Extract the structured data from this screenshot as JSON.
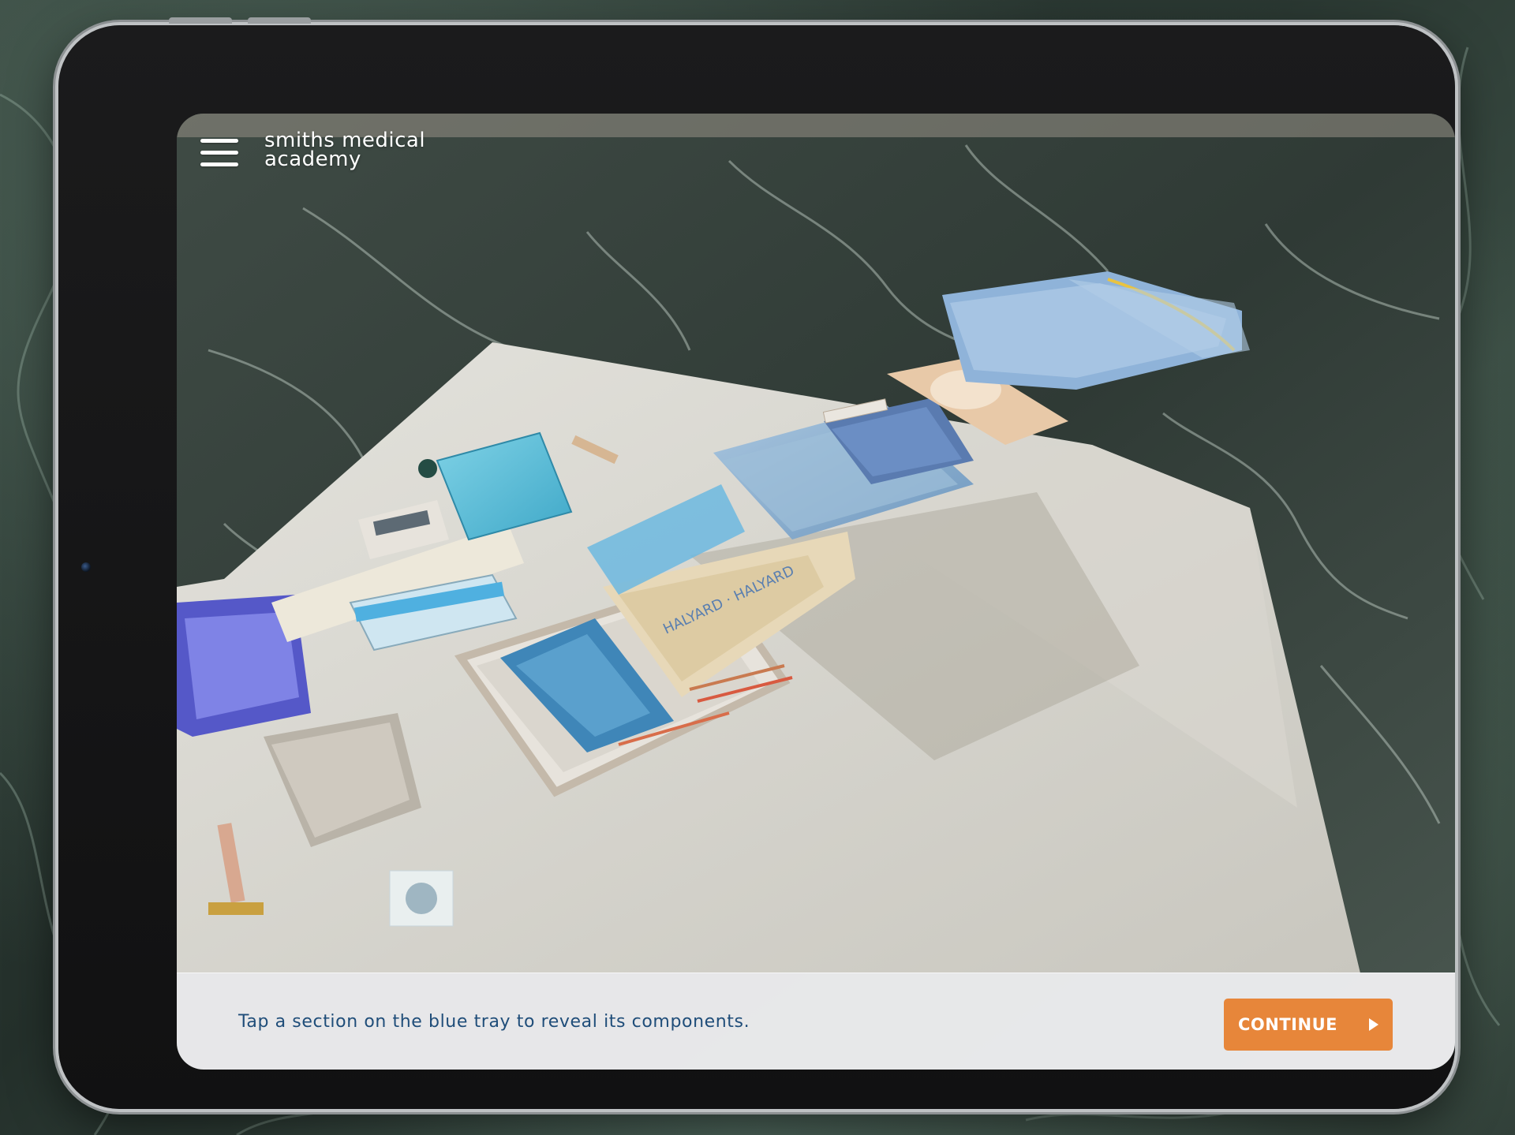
{
  "header": {
    "logo_line1": "smiths medical",
    "logo_line2": "academy"
  },
  "footer": {
    "instruction": "Tap a section on the blue tray to reveal its components.",
    "continue_label": "CONTINUE"
  },
  "icons": {
    "menu": "hamburger-menu-icon",
    "continue": "play-triangle-icon"
  },
  "colors": {
    "accent": "#e7863a",
    "instruction_text": "#1f4d79",
    "bar_background": "#eeeef0"
  }
}
